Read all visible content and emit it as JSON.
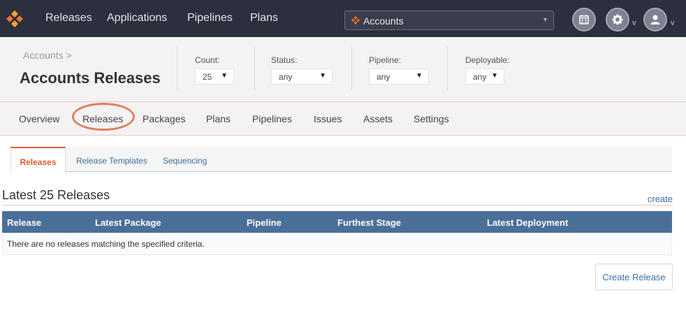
{
  "nav": {
    "items": [
      "Releases",
      "Applications",
      "Pipelines",
      "Plans"
    ],
    "app_select": {
      "value": "Accounts"
    },
    "user_caret": "v",
    "settings_caret": "v"
  },
  "header": {
    "breadcrumb": "Accounts >",
    "title": "Accounts Releases",
    "filters": [
      {
        "label": "Count:",
        "value": "25"
      },
      {
        "label": "Status:",
        "value": "any"
      },
      {
        "label": "Pipeline:",
        "value": "any"
      },
      {
        "label": "Deployable:",
        "value": "any"
      }
    ]
  },
  "subnav": {
    "items": [
      "Overview",
      "Releases",
      "Packages",
      "Plans",
      "Pipelines",
      "Issues",
      "Assets",
      "Settings"
    ],
    "active": "Releases"
  },
  "tabs": {
    "items": [
      "Releases",
      "Release Templates",
      "Sequencing"
    ],
    "active": "Releases"
  },
  "main": {
    "section_title": "Latest 25 Releases",
    "create_link": "create",
    "table": {
      "columns": [
        "Release",
        "Latest Package",
        "Pipeline",
        "Furthest Stage",
        "Latest Deployment"
      ],
      "empty_message": "There are no releases matching the specified criteria."
    },
    "create_button": "Create Release"
  },
  "colors": {
    "topbar": "#2b2f3e",
    "accent": "#e05a2d",
    "table_header": "#4a6f99",
    "link": "#3b6ea0"
  },
  "icons": {
    "logo": "logo-icon",
    "calendar": "calendar-icon",
    "settings": "gear-icon",
    "user": "user-icon"
  }
}
